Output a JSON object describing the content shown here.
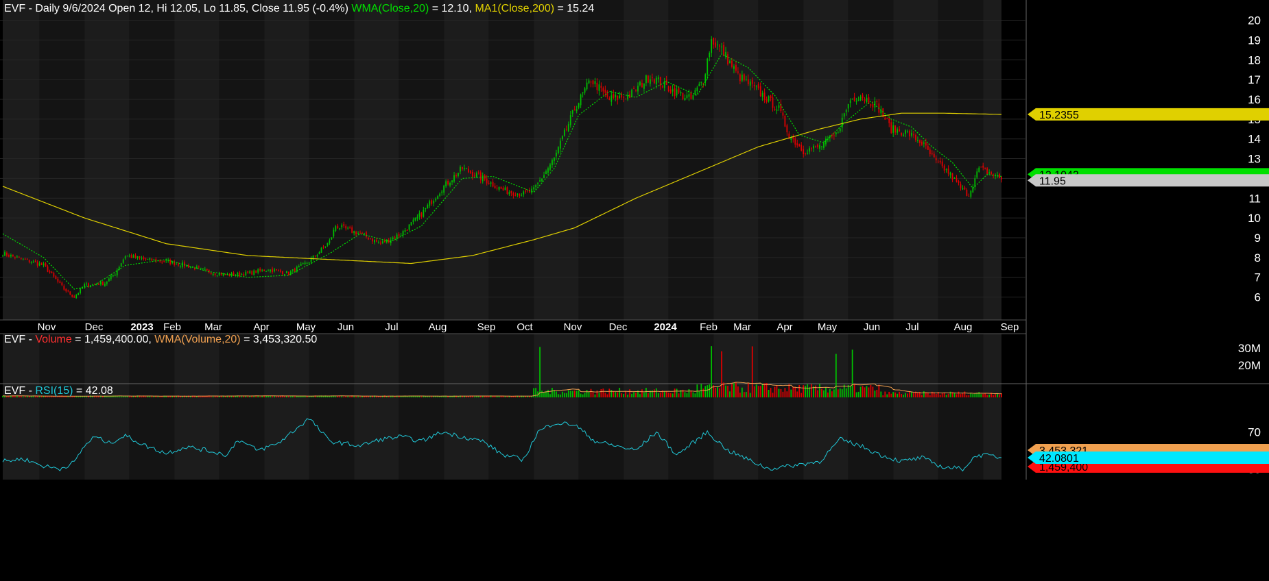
{
  "colors": {
    "background": "#000000",
    "panel_band_dark": "#141414",
    "panel_band_light": "#1c1c1c",
    "grid": "#262626",
    "up_candle": "#00c000",
    "down_candle": "#e00000",
    "wma_price": "#00dd00",
    "ma200": "#e0d000",
    "volume_wma": "#f0a050",
    "rsi": "#20c8d8",
    "text": "#ffffff"
  },
  "headers": {
    "price": [
      {
        "text": "EVF - Daily 9/6/2024 Open 12, Hi 12.05, Lo 11.85, Close 11.95 (-0.4%) ",
        "color": "#ffffff"
      },
      {
        "text": "WMA(Close,20)",
        "color": "#00dd00"
      },
      {
        "text": " = 12.10, ",
        "color": "#ffffff"
      },
      {
        "text": "MA1(Close,200)",
        "color": "#e0d000"
      },
      {
        "text": " = 15.24",
        "color": "#ffffff"
      }
    ],
    "volume": [
      {
        "text": "EVF - ",
        "color": "#ffffff"
      },
      {
        "text": "Volume",
        "color": "#ff3030"
      },
      {
        "text": " = 1,459,400.00, ",
        "color": "#ffffff"
      },
      {
        "text": "WMA(Volume,20)",
        "color": "#f0a050"
      },
      {
        "text": " = 3,453,320.50",
        "color": "#ffffff"
      }
    ],
    "rsi": [
      {
        "text": "EVF - ",
        "color": "#ffffff"
      },
      {
        "text": "RSI(15)",
        "color": "#20c8d8"
      },
      {
        "text": " = 42.08",
        "color": "#ffffff"
      }
    ]
  },
  "chart_data": [
    {
      "type": "candlestick",
      "panel": "price",
      "x_axis_labels": [
        "Nov",
        "Dec",
        "2023",
        "Feb",
        "Mar",
        "Apr",
        "May",
        "Jun",
        "Jul",
        "Aug",
        "Sep",
        "Oct",
        "Nov",
        "Dec",
        "2024",
        "Feb",
        "Mar",
        "Apr",
        "May",
        "Jun",
        "Jul",
        "Aug",
        "Sep"
      ],
      "y_tick_labels": [
        "6",
        "7",
        "8",
        "9",
        "10",
        "11",
        "12",
        "13",
        "14",
        "15",
        "16",
        "17",
        "18",
        "19",
        "20"
      ],
      "ylim": [
        5.5,
        20.4
      ],
      "series": [
        {
          "name": "WMA(Close,20)",
          "last_value": "12.1043"
        },
        {
          "name": "MA1(Close,200)",
          "last_value": "15.2355"
        },
        {
          "name": "Close",
          "last_value": "11.95"
        }
      ],
      "approx_close_path": [
        [
          0,
          8.2
        ],
        [
          20,
          7.6
        ],
        [
          30,
          6.4
        ],
        [
          35,
          6.0
        ],
        [
          40,
          6.6
        ],
        [
          50,
          6.7
        ],
        [
          55,
          7.2
        ],
        [
          60,
          8.1
        ],
        [
          70,
          7.9
        ],
        [
          80,
          7.8
        ],
        [
          90,
          7.6
        ],
        [
          100,
          7.3
        ],
        [
          110,
          7.1
        ],
        [
          120,
          7.2
        ],
        [
          130,
          7.4
        ],
        [
          140,
          7.2
        ],
        [
          150,
          7.8
        ],
        [
          160,
          8.8
        ],
        [
          163,
          9.6
        ],
        [
          175,
          9.2
        ],
        [
          185,
          8.7
        ],
        [
          195,
          9.2
        ],
        [
          205,
          10.2
        ],
        [
          215,
          11.5
        ],
        [
          225,
          12.5
        ],
        [
          235,
          12.0
        ],
        [
          245,
          11.4
        ],
        [
          255,
          11.2
        ],
        [
          260,
          11.4
        ],
        [
          270,
          13.0
        ],
        [
          280,
          15.5
        ],
        [
          288,
          17.0
        ],
        [
          297,
          16.0
        ],
        [
          307,
          16.2
        ],
        [
          317,
          17.2
        ],
        [
          327,
          16.5
        ],
        [
          337,
          16.0
        ],
        [
          343,
          17.0
        ],
        [
          347,
          19.0
        ],
        [
          352,
          18.5
        ],
        [
          360,
          17.2
        ],
        [
          370,
          16.4
        ],
        [
          380,
          15.5
        ],
        [
          385,
          14.2
        ],
        [
          392,
          13.4
        ],
        [
          400,
          13.6
        ],
        [
          408,
          14.2
        ],
        [
          415,
          16.0
        ],
        [
          420,
          16.2
        ],
        [
          428,
          15.7
        ],
        [
          435,
          14.5
        ],
        [
          443,
          14.3
        ],
        [
          450,
          13.8
        ],
        [
          457,
          12.8
        ],
        [
          463,
          12.3
        ],
        [
          470,
          11.4
        ],
        [
          473,
          11.2
        ],
        [
          478,
          12.5
        ],
        [
          485,
          12.2
        ],
        [
          489,
          11.95
        ]
      ],
      "approx_wma20_path": [
        [
          0,
          9.2
        ],
        [
          20,
          8.0
        ],
        [
          35,
          6.4
        ],
        [
          45,
          6.6
        ],
        [
          60,
          7.6
        ],
        [
          80,
          7.9
        ],
        [
          100,
          7.3
        ],
        [
          120,
          7.0
        ],
        [
          140,
          7.1
        ],
        [
          160,
          8.2
        ],
        [
          175,
          9.2
        ],
        [
          190,
          8.8
        ],
        [
          205,
          9.6
        ],
        [
          225,
          12.0
        ],
        [
          240,
          12.1
        ],
        [
          260,
          11.3
        ],
        [
          270,
          12.5
        ],
        [
          282,
          15.2
        ],
        [
          297,
          16.4
        ],
        [
          310,
          16.1
        ],
        [
          325,
          16.9
        ],
        [
          340,
          16.2
        ],
        [
          352,
          18.3
        ],
        [
          365,
          17.6
        ],
        [
          378,
          16.2
        ],
        [
          390,
          14.2
        ],
        [
          402,
          13.8
        ],
        [
          412,
          14.8
        ],
        [
          425,
          15.9
        ],
        [
          435,
          15.0
        ],
        [
          445,
          14.6
        ],
        [
          455,
          13.6
        ],
        [
          465,
          12.8
        ],
        [
          475,
          11.5
        ],
        [
          482,
          12.2
        ],
        [
          489,
          12.1
        ]
      ],
      "approx_ma200_path": [
        [
          0,
          11.6
        ],
        [
          40,
          10.0
        ],
        [
          80,
          8.7
        ],
        [
          120,
          8.1
        ],
        [
          160,
          7.9
        ],
        [
          200,
          7.7
        ],
        [
          230,
          8.1
        ],
        [
          260,
          8.9
        ],
        [
          280,
          9.5
        ],
        [
          310,
          11.0
        ],
        [
          340,
          12.3
        ],
        [
          370,
          13.6
        ],
        [
          400,
          14.5
        ],
        [
          420,
          15.0
        ],
        [
          440,
          15.3
        ],
        [
          460,
          15.3
        ],
        [
          489,
          15.24
        ]
      ]
    },
    {
      "type": "bar",
      "panel": "volume",
      "y_tick_labels": [
        "20M",
        "30M"
      ],
      "series": [
        {
          "name": "Volume",
          "last_value": "1,459,400"
        },
        {
          "name": "WMA(Volume,20)",
          "last_value": "3,453,321"
        }
      ]
    },
    {
      "type": "line",
      "panel": "rsi",
      "y_tick_labels": [
        "30",
        "70"
      ],
      "ylim": [
        22,
        95
      ],
      "series": [
        {
          "name": "RSI(15)",
          "last_value": "42.0801"
        }
      ],
      "approx_path": [
        [
          0,
          38
        ],
        [
          10,
          41
        ],
        [
          20,
          33
        ],
        [
          28,
          30
        ],
        [
          35,
          37
        ],
        [
          40,
          55
        ],
        [
          45,
          65
        ],
        [
          52,
          58
        ],
        [
          60,
          66
        ],
        [
          70,
          55
        ],
        [
          80,
          47
        ],
        [
          90,
          54
        ],
        [
          100,
          50
        ],
        [
          110,
          45
        ],
        [
          115,
          62
        ],
        [
          125,
          50
        ],
        [
          135,
          58
        ],
        [
          150,
          85
        ],
        [
          160,
          60
        ],
        [
          175,
          55
        ],
        [
          185,
          62
        ],
        [
          195,
          65
        ],
        [
          205,
          60
        ],
        [
          215,
          70
        ],
        [
          225,
          65
        ],
        [
          235,
          60
        ],
        [
          245,
          45
        ],
        [
          255,
          40
        ],
        [
          262,
          70
        ],
        [
          270,
          80
        ],
        [
          280,
          78
        ],
        [
          290,
          60
        ],
        [
          300,
          55
        ],
        [
          310,
          50
        ],
        [
          320,
          70
        ],
        [
          330,
          45
        ],
        [
          345,
          70
        ],
        [
          355,
          50
        ],
        [
          365,
          40
        ],
        [
          375,
          30
        ],
        [
          385,
          33
        ],
        [
          400,
          38
        ],
        [
          410,
          62
        ],
        [
          420,
          55
        ],
        [
          430,
          45
        ],
        [
          440,
          38
        ],
        [
          450,
          42
        ],
        [
          460,
          32
        ],
        [
          470,
          30
        ],
        [
          477,
          45
        ],
        [
          485,
          44
        ],
        [
          489,
          42
        ]
      ]
    }
  ]
}
